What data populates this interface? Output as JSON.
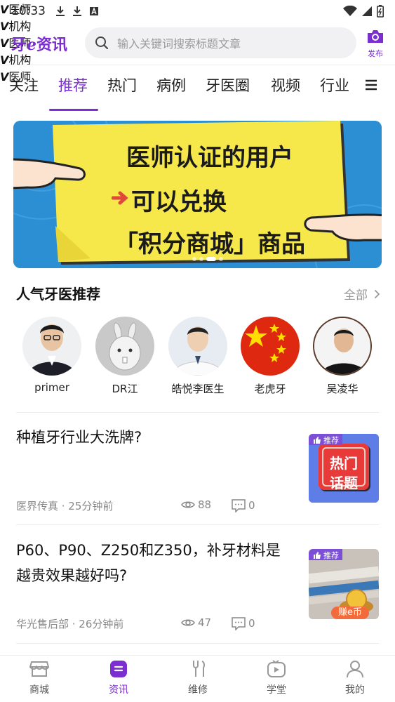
{
  "status_bar": {
    "time": "10:33"
  },
  "header": {
    "logo_prefix": "牙",
    "logo_e": "e",
    "logo_suffix": "资讯",
    "search_placeholder": "输入关键词搜索标题文章",
    "publish_label": "发布"
  },
  "tabs": [
    {
      "label": "关注"
    },
    {
      "label": "推荐"
    },
    {
      "label": "热门"
    },
    {
      "label": "病例"
    },
    {
      "label": "牙医圈"
    },
    {
      "label": "视频"
    },
    {
      "label": "行业"
    }
  ],
  "active_tab": "推荐",
  "banner": {
    "line1": "医师认证的用户",
    "line2": "可以兑换",
    "line3": "「积分商城」商品",
    "slide_count": 4,
    "active_slide": 3
  },
  "recommend": {
    "title": "人气牙医推荐",
    "all_label": "全部",
    "doctors": [
      {
        "name": "primer",
        "badge": "医师"
      },
      {
        "name": "DR江",
        "badge": "机构"
      },
      {
        "name": "皓悦李医生",
        "badge": "医师"
      },
      {
        "name": "老虎牙",
        "badge": "机构"
      },
      {
        "name": "吴凌华",
        "badge": "医师"
      }
    ]
  },
  "articles": [
    {
      "title": "种植牙行业大洗牌?",
      "source_time": "医界传真 · 25分钟前",
      "views": "88",
      "comments": "0",
      "thumb_tag": "推荐",
      "thumb_text_1": "热门",
      "thumb_text_2": "话题"
    },
    {
      "title": "P60、P90、Z250和Z350，补牙材料是越贵效果越好吗?",
      "source_time": "华光售后部 · 26分钟前",
      "views": "47",
      "comments": "0",
      "thumb_tag": "推荐",
      "thumb_coin_label": "赚e币"
    }
  ],
  "bottom_nav": [
    {
      "label": "商城"
    },
    {
      "label": "资讯"
    },
    {
      "label": "维修"
    },
    {
      "label": "学堂"
    },
    {
      "label": "我的"
    }
  ],
  "active_nav": "资讯",
  "colors": {
    "accent": "#7b2fd0",
    "banner_yellow": "#f6e84a",
    "banner_blue": "#2c8fd4"
  }
}
